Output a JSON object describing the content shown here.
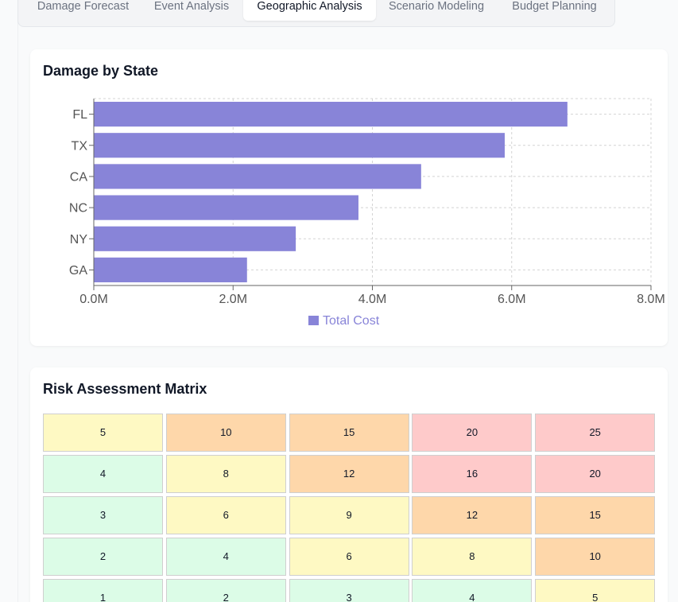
{
  "tabs": [
    {
      "label": "Damage Forecast",
      "active": false
    },
    {
      "label": "Event Analysis",
      "active": false
    },
    {
      "label": "Geographic Analysis",
      "active": true
    },
    {
      "label": "Scenario Modeling",
      "active": false
    },
    {
      "label": "Budget Planning",
      "active": false
    }
  ],
  "damage_card": {
    "title": "Damage by State"
  },
  "chart_data": {
    "type": "bar",
    "orientation": "horizontal",
    "title": "Damage by State",
    "categories": [
      "FL",
      "TX",
      "CA",
      "NC",
      "NY",
      "GA"
    ],
    "series": [
      {
        "name": "Total Cost",
        "values": [
          6.8,
          5.9,
          4.7,
          3.8,
          2.9,
          2.2
        ],
        "color": "#8884d8"
      }
    ],
    "x_ticks": [
      "0.0M",
      "2.0M",
      "4.0M",
      "6.0M",
      "8.0M"
    ],
    "xlim": [
      0,
      8
    ],
    "grid": true,
    "legend_position": "bottom"
  },
  "risk_card": {
    "title": "Risk Assessment Matrix",
    "rows": [
      [
        5,
        10,
        15,
        20,
        25
      ],
      [
        4,
        8,
        12,
        16,
        20
      ],
      [
        3,
        6,
        9,
        12,
        15
      ],
      [
        2,
        4,
        6,
        8,
        10
      ],
      [
        1,
        2,
        3,
        4,
        5
      ]
    ],
    "colors": {
      "low": "#dcfce7",
      "medium": "#fef9c3",
      "high": "#fed7aa",
      "critical": "#fecaca"
    }
  }
}
